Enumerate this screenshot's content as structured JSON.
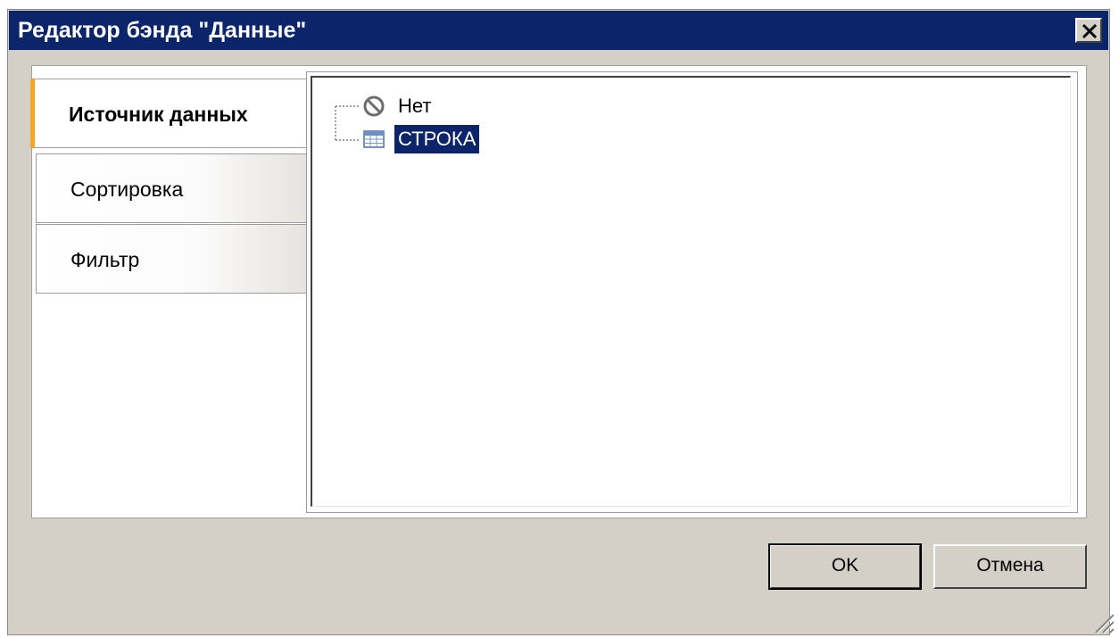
{
  "window": {
    "title": "Редактор бэнда \"Данные\"",
    "accent_color": "#0b246a",
    "tab_accent_color": "#f5a623"
  },
  "tabs": [
    {
      "label": "Источник данных",
      "active": true
    },
    {
      "label": "Сортировка",
      "active": false
    },
    {
      "label": "Фильтр",
      "active": false
    }
  ],
  "tree": {
    "items": [
      {
        "label": "Нет",
        "icon": "no-symbol-icon",
        "selected": false
      },
      {
        "label": "СТРОКА",
        "icon": "table-icon",
        "selected": true
      }
    ]
  },
  "buttons": {
    "ok_label": "OK",
    "cancel_label": "Отмена"
  },
  "icons": {
    "close": "close-icon",
    "resize": "resize-grip-icon"
  }
}
